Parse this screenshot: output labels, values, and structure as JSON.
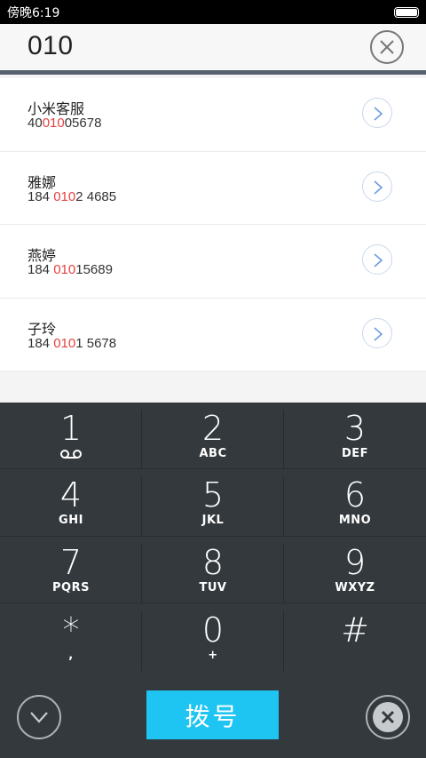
{
  "status": {
    "time": "傍晚6:19"
  },
  "search": {
    "query": "010"
  },
  "results": [
    {
      "name": "小米客服",
      "num_pre": "40",
      "num_hl": "010",
      "num_post": "05678"
    },
    {
      "name": "雅娜",
      "num_pre": "184 ",
      "num_hl": "010",
      "num_post": "2 4685"
    },
    {
      "name": "燕婷",
      "num_pre": "184 ",
      "num_hl": "010",
      "num_post": "15689"
    },
    {
      "name": "子玲",
      "num_pre": "184 ",
      "num_hl": "010",
      "num_post": "1 5678"
    }
  ],
  "keypad": {
    "keys": [
      {
        "digit": "1",
        "letters": ""
      },
      {
        "digit": "2",
        "letters": "ABC"
      },
      {
        "digit": "3",
        "letters": "DEF"
      },
      {
        "digit": "4",
        "letters": "GHI"
      },
      {
        "digit": "5",
        "letters": "JKL"
      },
      {
        "digit": "6",
        "letters": "MNO"
      },
      {
        "digit": "7",
        "letters": "PQRS"
      },
      {
        "digit": "8",
        "letters": "TUV"
      },
      {
        "digit": "9",
        "letters": "WXYZ"
      },
      {
        "digit": "*",
        "letters": ","
      },
      {
        "digit": "0",
        "letters": "+"
      },
      {
        "digit": "#",
        "letters": ""
      }
    ],
    "dial_label": "拨号"
  },
  "colors": {
    "highlight": "#e64040",
    "dial_button": "#1ec4f2",
    "keypad_bg": "#33393d"
  }
}
